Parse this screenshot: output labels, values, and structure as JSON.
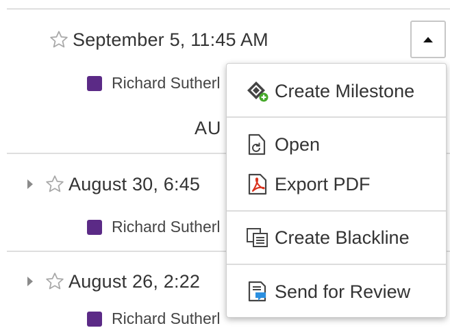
{
  "entries": [
    {
      "date": "September 5, 11:45 AM",
      "author": "Richard Sutherl",
      "expandable": false
    },
    {
      "date": "August 30, 6:45",
      "author": "Richard Sutherl",
      "expandable": true
    },
    {
      "date": "August 26, 2:22",
      "author": "Richard Sutherl",
      "expandable": true
    }
  ],
  "month_group_label": "AU",
  "menu": {
    "items": [
      {
        "label": "Create Milestone",
        "icon": "create-milestone-icon"
      },
      {
        "label": "Open",
        "icon": "open-icon"
      },
      {
        "label": "Export PDF",
        "icon": "export-pdf-icon"
      },
      {
        "label": "Create Blackline",
        "icon": "create-blackline-icon"
      },
      {
        "label": "Send for Review",
        "icon": "send-for-review-icon"
      }
    ]
  },
  "colors": {
    "author_swatch": "#5b2a86",
    "milestone_plus": "#45a829",
    "pdf_red": "#d9331e",
    "review_blue": "#2b8fe0"
  }
}
